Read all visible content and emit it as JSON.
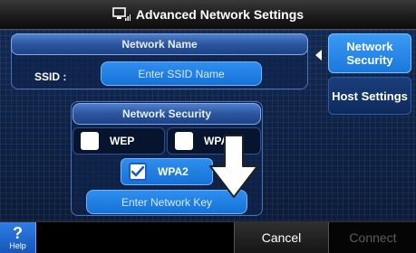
{
  "header": {
    "title": "Advanced Network Settings"
  },
  "network_name": {
    "panel_title": "Network Name",
    "ssid_label": "SSID :",
    "ssid_field_placeholder": "Enter SSID Name"
  },
  "network_security": {
    "panel_title": "Network Security",
    "options": [
      {
        "label": "WEP",
        "checked": false
      },
      {
        "label": "WPA",
        "checked": false
      },
      {
        "label": "WPA2",
        "checked": true
      }
    ],
    "network_key_button": "Enter Network Key"
  },
  "sidebar": {
    "items": [
      {
        "label": "Network Security",
        "active": true
      },
      {
        "label": "Host Settings",
        "active": false
      }
    ]
  },
  "footer": {
    "help_glyph": "?",
    "help_label": "Help",
    "cancel_label": "Cancel",
    "connect_label": "Connect"
  },
  "colors": {
    "accent_blue": "#1a78dc",
    "panel_title_blue": "#2b559f",
    "background_navy": "#0c1c3a",
    "disabled_text": "#5c5c5c"
  },
  "icons": {
    "title": "network-signal-icon",
    "checked": "checkmark-icon",
    "pointer": "down-arrow-icon",
    "sidebar_indicator": "caret-left-icon"
  }
}
